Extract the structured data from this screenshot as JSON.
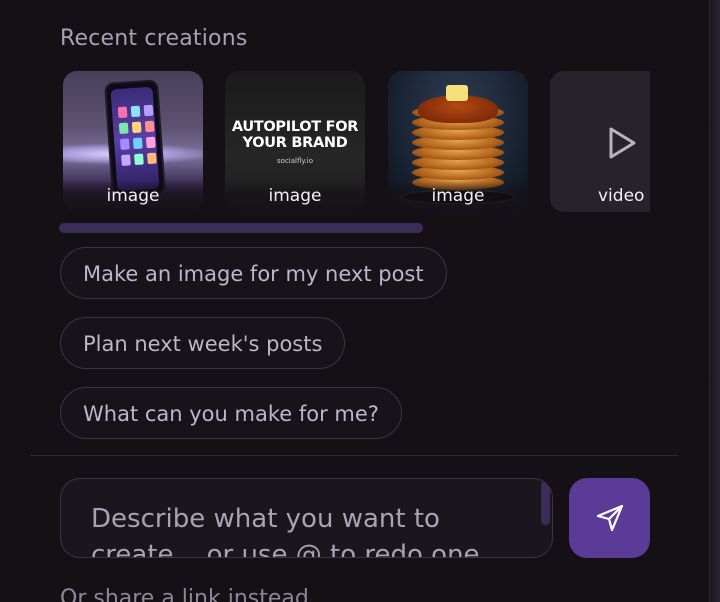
{
  "section": {
    "title": "Recent creations"
  },
  "carousel": {
    "items": [
      {
        "label": "image",
        "kind": "phone-image"
      },
      {
        "label": "image",
        "kind": "poster-image",
        "headline": "AUTOPILOT FOR YOUR BRAND",
        "url": "socialfly.io"
      },
      {
        "label": "image",
        "kind": "pancake-image"
      },
      {
        "label": "video",
        "kind": "video",
        "icon": "play-icon"
      }
    ]
  },
  "suggestions": [
    "Make an image for my next post",
    "Plan next week's posts",
    "What can you make for me?"
  ],
  "composer": {
    "placeholder": "Describe what you want to create... or use @ to redo one",
    "send_icon": "send-icon"
  },
  "share_link": "Or share a link instead",
  "colors": {
    "background": "#141016",
    "accent": "#5b3a98",
    "scrollbar": "#3b2d5a"
  }
}
